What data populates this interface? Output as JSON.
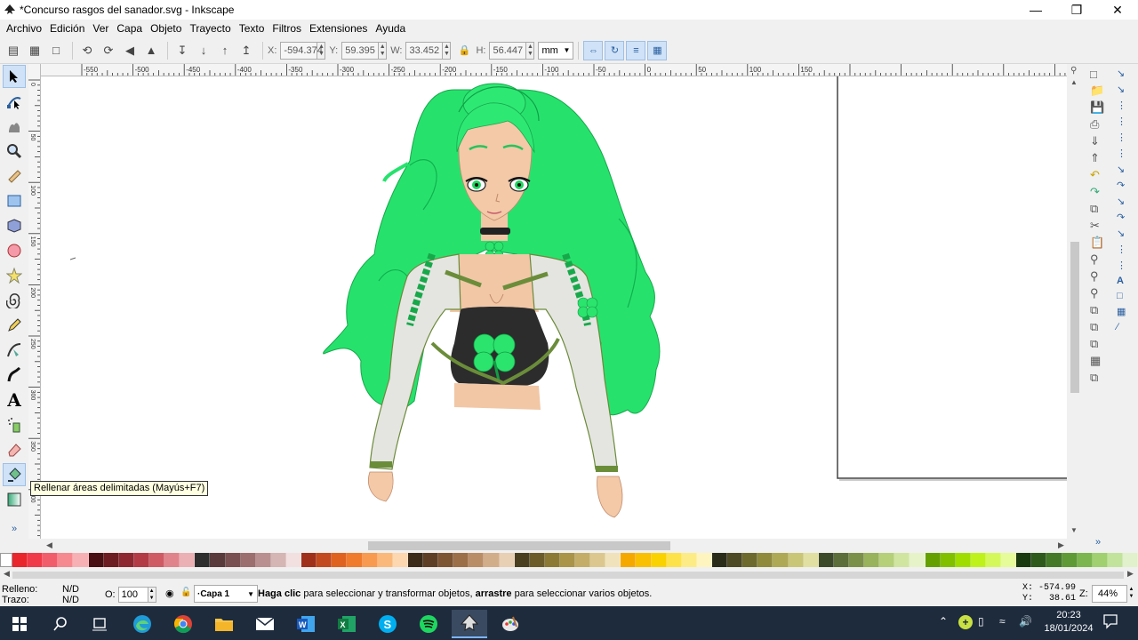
{
  "window": {
    "title": "*Concurso rasgos del sanador.svg - Inkscape"
  },
  "menu": [
    "Archivo",
    "Edición",
    "Ver",
    "Capa",
    "Objeto",
    "Trayecto",
    "Texto",
    "Filtros",
    "Extensiones",
    "Ayuda"
  ],
  "toolbar": {
    "x_label": "X:",
    "x_value": "-594.374",
    "y_label": "Y:",
    "y_value": "59.395",
    "w_label": "W:",
    "w_value": "33.452",
    "h_label": "H:",
    "h_value": "56.447",
    "unit": "mm"
  },
  "ruler_top": [
    "-550",
    "-500",
    "-450",
    "-400",
    "-350",
    "-300",
    "-250",
    "-200",
    "-150",
    "-100",
    "-50",
    "0",
    "50",
    "100",
    "150"
  ],
  "ruler_left": [
    "0",
    "50",
    "100",
    "150",
    "200",
    "250",
    "300",
    "350",
    "400",
    "450",
    "500"
  ],
  "tooltip": "Rellenar áreas delimitadas (Mayús+F7)",
  "status": {
    "fill_label": "Relleno:",
    "fill_value": "N/D",
    "stroke_label": "Trazo:",
    "stroke_value": "N/D",
    "opacity_label": "O:",
    "opacity_value": "100",
    "layer": "·Capa 1",
    "msg_bold1": "Haga clic",
    "msg_1": " para seleccionar y transformar objetos, ",
    "msg_bold2": "arrastre",
    "msg_2": " para seleccionar varios objetos.",
    "cursor_x": "X: -574.99",
    "cursor_y": "Y:   38.61",
    "zoom_label": "Z:",
    "zoom_value": "44%"
  },
  "taskbar": {
    "time": "20:23",
    "date": "18/01/2024"
  },
  "palette": [
    "#e8262b",
    "#f03a4a",
    "#f25d6c",
    "#f6898f",
    "#f7b1b5",
    "#4a0f12",
    "#6d1c22",
    "#8f2730",
    "#b33b45",
    "#cf5a63",
    "#e1838a",
    "#eab0b4",
    "#2e2e2e",
    "#5a3a3a",
    "#7a5050",
    "#9c6e6e",
    "#b98f8f",
    "#d6b5b5",
    "#f2e0e0",
    "#a0301a",
    "#c24a1e",
    "#e0621f",
    "#f07b2c",
    "#f89a4f",
    "#fab97b",
    "#fcd7b0",
    "#3d2b1a",
    "#5e3f25",
    "#7d5533",
    "#9c6f48",
    "#b98d66",
    "#d2ad8a",
    "#e8d0b5",
    "#4a4020",
    "#6b5c2a",
    "#8c7a34",
    "#a9944a",
    "#c4ae67",
    "#dcc88e",
    "#f0e2ba",
    "#f5a800",
    "#f8c000",
    "#fad200",
    "#fde24a",
    "#fdeb86",
    "#fef4c0",
    "#2b2b1a",
    "#4d4a24",
    "#6e6a2e",
    "#8f8a3c",
    "#ada955",
    "#c9c678",
    "#e1dfa2",
    "#3d4a2a",
    "#5c6e3a",
    "#7b914a",
    "#99b25c",
    "#b6cf79",
    "#d0e59f",
    "#e6f3c9",
    "#64a000",
    "#80c000",
    "#9fdc00",
    "#bff21a",
    "#d4f85a",
    "#e6fb9a",
    "#1a3a10",
    "#2e5a1c",
    "#447a28",
    "#5e9a36",
    "#7cb64e",
    "#a0d070",
    "#c2e39c",
    "#e0f1cb"
  ]
}
